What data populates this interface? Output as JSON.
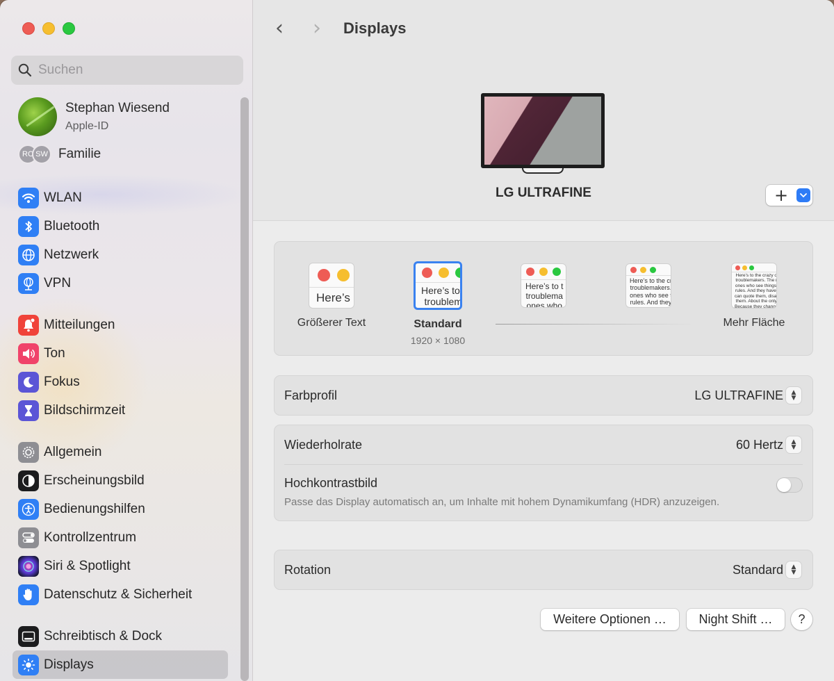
{
  "window": {
    "traffic_lights": [
      "close",
      "minimize",
      "zoom"
    ]
  },
  "sidebar": {
    "search_placeholder": "Suchen",
    "profile": {
      "name": "Stephan Wiesend",
      "subtitle": "Apple-ID"
    },
    "family": {
      "avatars": [
        "RC",
        "SW"
      ],
      "label": "Familie"
    },
    "groups": [
      [
        {
          "label": "WLAN",
          "icon": "wifi-icon",
          "color": "#2f7ff5"
        },
        {
          "label": "Bluetooth",
          "icon": "bluetooth-icon",
          "color": "#2f7ff5"
        },
        {
          "label": "Netzwerk",
          "icon": "globe-icon",
          "color": "#2f7ff5"
        },
        {
          "label": "VPN",
          "icon": "vpn-globe-icon",
          "color": "#2f7ff5"
        }
      ],
      [
        {
          "label": "Mitteilungen",
          "icon": "bell-icon",
          "color": "#f0433a"
        },
        {
          "label": "Ton",
          "icon": "speaker-icon",
          "color": "#f0436a"
        },
        {
          "label": "Fokus",
          "icon": "moon-icon",
          "color": "#5b55d6"
        },
        {
          "label": "Bildschirmzeit",
          "icon": "hourglass-icon",
          "color": "#5b55d6"
        }
      ],
      [
        {
          "label": "Allgemein",
          "icon": "gear-icon",
          "color": "#8e8e93"
        },
        {
          "label": "Erscheinungsbild",
          "icon": "appearance-icon",
          "color": "#1c1c1e"
        },
        {
          "label": "Bedienungshilfen",
          "icon": "accessibility-icon",
          "color": "#2f7ff5"
        },
        {
          "label": "Kontrollzentrum",
          "icon": "switches-icon",
          "color": "#8e8e93"
        },
        {
          "label": "Siri & Spotlight",
          "icon": "siri-icon",
          "color": "#3a3a8a"
        },
        {
          "label": "Datenschutz & Sicherheit",
          "icon": "hand-icon",
          "color": "#2f7ff5"
        }
      ],
      [
        {
          "label": "Schreibtisch & Dock",
          "icon": "dock-icon",
          "color": "#1c1c1e"
        },
        {
          "label": "Displays",
          "icon": "brightness-icon",
          "color": "#2f7ff5",
          "active": true
        }
      ]
    ]
  },
  "main": {
    "title": "Displays",
    "display_name": "LG ULTRAFINE",
    "add_button": "+",
    "resolution": {
      "options": [
        {
          "label": "Größerer Text",
          "preview_text": "Here’s"
        },
        {
          "label": "Standard",
          "sublabel": "1920 × 1080",
          "selected": true,
          "preview_text": "Here’s to t\ntroublem"
        },
        {
          "label": "",
          "preview_text": "Here’s to t\ntroublema\nones who"
        },
        {
          "label": "",
          "preview_text": "Here’s to the cr\ntroublemakers.\nones who see t\nrules. And they"
        },
        {
          "label": "Mehr Fläche",
          "preview_text": "Here’s to the crazy one\ntroublemakers. The rou\nones who see things dif\nrules. And they have no\ncan quote them, disagre\nthem. About the only th\nBecause they change th"
        }
      ]
    },
    "settings": {
      "color_profile": {
        "label": "Farbprofil",
        "value": "LG ULTRAFINE"
      },
      "refresh_rate": {
        "label": "Wiederholrate",
        "value": "60 Hertz"
      },
      "hdr": {
        "label": "Hochkontrastbild",
        "description": "Passe das Display automatisch an, um Inhalte mit hohem Dynamikumfang (HDR) anzuzeigen.",
        "enabled": false
      },
      "rotation": {
        "label": "Rotation",
        "value": "Standard"
      }
    },
    "buttons": {
      "more_options": "Weitere Optionen …",
      "night_shift": "Night Shift …",
      "help": "?"
    }
  }
}
